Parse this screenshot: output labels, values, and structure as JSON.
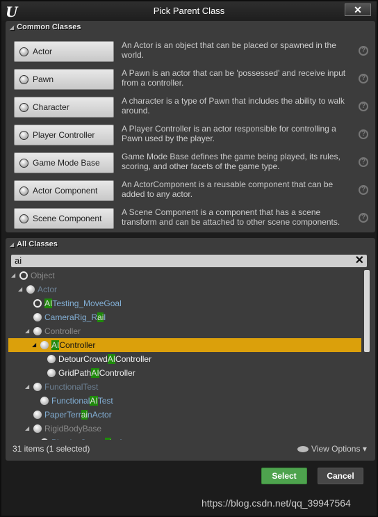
{
  "window": {
    "title": "Pick Parent Class",
    "close_icon": "close-icon",
    "logo": "U"
  },
  "common": {
    "header": "Common Classes",
    "items": [
      {
        "label": "Actor",
        "icon": "actor-sphere-icon",
        "desc": "An Actor is an object that can be placed or spawned in the world."
      },
      {
        "label": "Pawn",
        "icon": "pawn-icon",
        "desc": "A Pawn is an actor that can be 'possessed' and receive input from a controller."
      },
      {
        "label": "Character",
        "icon": "character-icon",
        "desc": "A character is a type of Pawn that includes the ability to walk around."
      },
      {
        "label": "Player Controller",
        "icon": "player-controller-icon",
        "desc": "A Player Controller is an actor responsible for controlling a Pawn used by the player."
      },
      {
        "label": "Game Mode Base",
        "icon": "game-mode-icon",
        "desc": "Game Mode Base defines the game being played, its rules, scoring, and other facets of the game type."
      },
      {
        "label": "Actor Component",
        "icon": "actor-component-icon",
        "desc": "An ActorComponent is a reusable component that can be added to any actor."
      },
      {
        "label": "Scene Component",
        "icon": "scene-component-icon",
        "desc": "A Scene Component is a component that has a scene transform and can be attached to other scene components."
      }
    ]
  },
  "all": {
    "header": "All Classes",
    "search_value": "ai",
    "rows": [
      {
        "pre": "Object",
        "m": "",
        "post": "",
        "level": 0,
        "arrow": true,
        "color": "gray",
        "ring": true
      },
      {
        "pre": "Actor",
        "m": "",
        "post": "",
        "level": 1,
        "arrow": true,
        "color": "bg"
      },
      {
        "pre": "",
        "m": "AI",
        "post": "Testing_MoveGoal",
        "level": 2,
        "arrow": false,
        "color": "bp",
        "ring": true
      },
      {
        "pre": "CameraRig_R",
        "m": "ai",
        "post": "l",
        "level": 2,
        "arrow": false,
        "color": "bp"
      },
      {
        "pre": "Controller",
        "m": "",
        "post": "",
        "level": 2,
        "arrow": true,
        "color": "gray"
      },
      {
        "pre": "",
        "m": "AI",
        "post": "Controller",
        "level": 3,
        "arrow": true,
        "color": "wh",
        "selected": true
      },
      {
        "pre": "DetourCrowd",
        "m": "AI",
        "post": "Controller",
        "level": 4,
        "arrow": false,
        "color": "wh"
      },
      {
        "pre": "GridPath",
        "m": "AI",
        "post": "Controller",
        "level": 4,
        "arrow": false,
        "color": "wh"
      },
      {
        "pre": "FunctionalTest",
        "m": "",
        "post": "",
        "level": 2,
        "arrow": true,
        "color": "bg"
      },
      {
        "pre": "Functional",
        "m": "AI",
        "post": "Test",
        "level": 3,
        "arrow": false,
        "color": "bp"
      },
      {
        "pre": "PaperTerr",
        "m": "ai",
        "post": "nActor",
        "level": 2,
        "arrow": false,
        "color": "bp"
      },
      {
        "pre": "RigidBodyBase",
        "m": "",
        "post": "",
        "level": 2,
        "arrow": true,
        "color": "gray"
      },
      {
        "pre": "PhysicsConstr",
        "m": "ai",
        "post": "ntActor",
        "level": 3,
        "arrow": false,
        "color": "bp"
      }
    ]
  },
  "footer": {
    "count": "31 items (1 selected)",
    "view_options": "View Options"
  },
  "buttons": {
    "select": "Select",
    "cancel": "Cancel"
  },
  "colors": {
    "selected": "#dba00b",
    "match": "#1f8a0b",
    "select_button": "#4ea34e"
  },
  "watermark": "https://blog.csdn.net/qq_39947564"
}
